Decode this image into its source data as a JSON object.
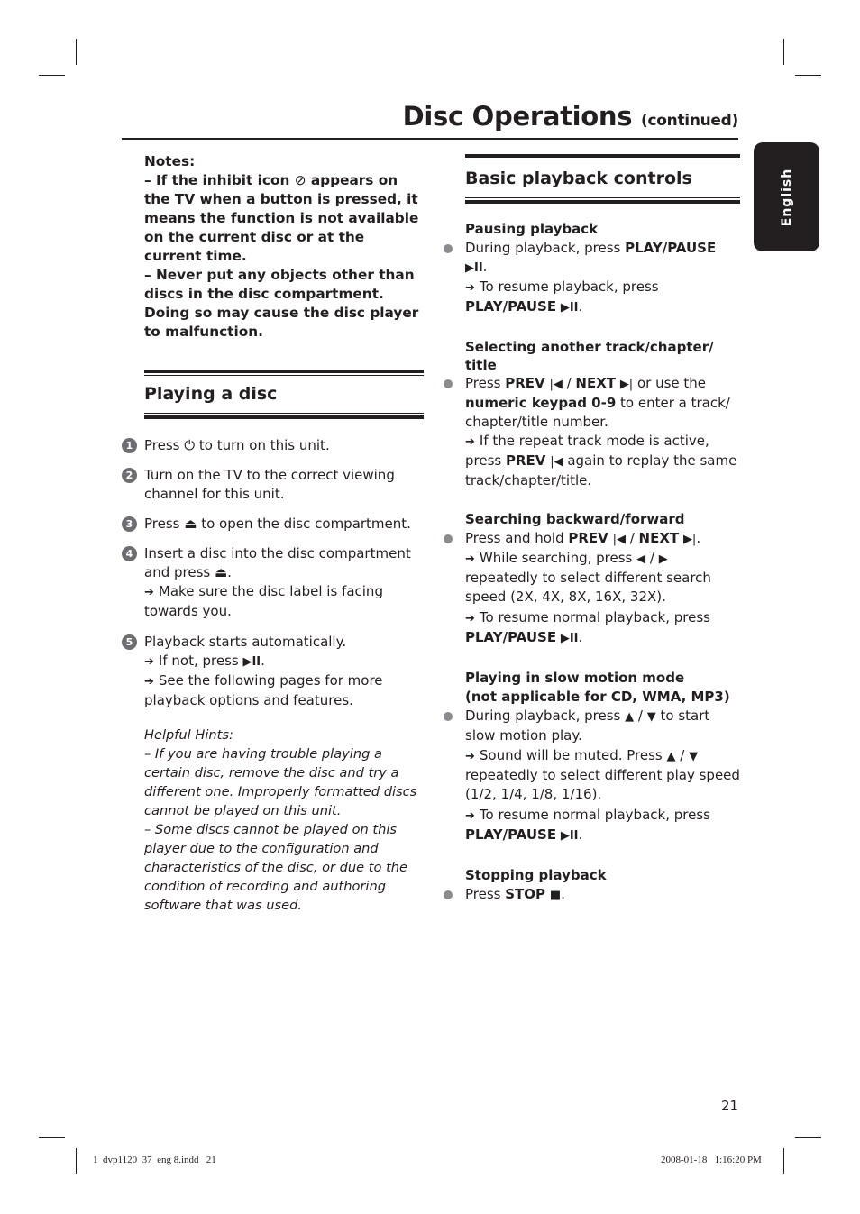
{
  "header": {
    "title": "Disc Operations",
    "title_suffix": "(continued)",
    "language_tab": "English"
  },
  "notes": {
    "heading": "Notes:",
    "items": [
      {
        "prefix": "–  If the inhibit icon ",
        "icon": "inhibit-icon",
        "suffix": " appears on the TV when a button is pressed, it means the function is not available on the current disc or at the current time."
      },
      {
        "text": "–  Never put any objects other than discs in the disc compartment. Doing so may cause the disc player to malfunction."
      }
    ]
  },
  "playing_a_disc": {
    "title": "Playing a disc",
    "steps": [
      {
        "num": "1",
        "a": "Press ",
        "icon": "power-icon",
        "b": " to turn on this unit."
      },
      {
        "num": "2",
        "text": "Turn on the TV to the correct viewing channel for this unit."
      },
      {
        "num": "3",
        "a": "Press ",
        "icon": "eject-icon",
        "b": " to open the disc compartment."
      },
      {
        "num": "4",
        "a": "Insert a disc into the disc compartment and press ",
        "icon": "eject-icon",
        "b": ".",
        "result": "Make sure the disc label is facing towards you."
      },
      {
        "num": "5",
        "text": "Playback starts automatically.",
        "result1": "If not, press ",
        "result1_icon": "play-pause-icon",
        "result1_end": ".",
        "result2": "See the following pages for more playback options and features."
      }
    ],
    "hints": {
      "heading": "Helpful Hints:",
      "items": [
        "–  If you are having trouble playing a certain disc, remove the disc and try a different one. Improperly formatted discs cannot be played on this unit.",
        "–  Some discs cannot be played on this player due to the configuration and characteristics of the disc, or due to the condition of recording and authoring software that was used."
      ]
    }
  },
  "basic_playback": {
    "title": "Basic playback controls",
    "sections": {
      "pausing": {
        "heading": "Pausing playback",
        "line_a": "During playback, press ",
        "line_b": "PLAY/PAUSE",
        "result": "To resume playback, press ",
        "result_b": "PLAY/PAUSE"
      },
      "selecting": {
        "heading": "Selecting another track/chapter/ title",
        "a": "Press ",
        "prev": "PREV",
        "sep": " / ",
        "next": "NEXT",
        "b": " or use the ",
        "keypad": "numeric keypad 0-9",
        "c": " to enter a track/ chapter/title number.",
        "result_a": "If the repeat track mode is active, press ",
        "result_prev": "PREV",
        "result_b": " again to replay the same track/chapter/title."
      },
      "searching": {
        "heading": "Searching backward/forward",
        "a": "Press and hold ",
        "prev": "PREV",
        "next": "NEXT",
        "result1_a": "While searching, press ",
        "result1_b": " repeatedly to select different search speed (2X, 4X, 8X, 16X, 32X).",
        "result2": "To resume normal playback, press ",
        "result2_b": "PLAY/PAUSE"
      },
      "slow": {
        "heading": "Playing in slow motion mode",
        "heading2": "(not applicable for CD, WMA, MP3)",
        "a": "During playback, press ",
        "b": " to start slow motion play.",
        "result1_a": "Sound will be muted. Press ",
        "result1_b": " repeatedly to select different play speed (1/2, 1/4, 1/8, 1/16).",
        "result2": "To resume normal playback, press ",
        "result2_b": "PLAY/PAUSE"
      },
      "stopping": {
        "heading": "Stopping playback",
        "a": "Press ",
        "stop": "STOP"
      }
    }
  },
  "symbols": {
    "arrow": "➔",
    "inhibit": "⊘",
    "power": "⏻",
    "eject": "⏏",
    "play_pause": "▶II",
    "prev": "|◀",
    "next": "▶|",
    "left": "◀",
    "right": "▶",
    "up": "▲",
    "down": "▼",
    "stop": "■",
    "slash": " / "
  },
  "footer": {
    "page_number": "21",
    "file_name": "1_dvp1120_37_eng 8.indd   21",
    "timestamp": "2008-01-18   1:16:20 PM"
  }
}
